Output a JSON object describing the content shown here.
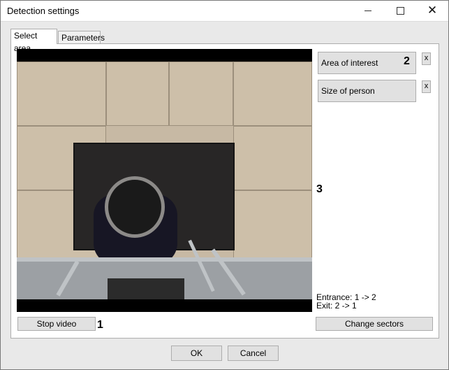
{
  "window": {
    "title": "Detection settings",
    "controls": {
      "minimize_icon": "minimize-icon",
      "maximize_icon": "maximize-icon",
      "close_icon": "close-icon",
      "close_glyph": "✕"
    }
  },
  "tabs": [
    {
      "label": "Select area",
      "active": true
    },
    {
      "label": "Parameters",
      "active": false
    }
  ],
  "side_panel": {
    "area_of_interest_label": "Area of interest",
    "size_of_person_label": "Size of person",
    "remove_label": "x",
    "entrance_text": "Entrance: 1 -> 2",
    "exit_text": "Exit: 2 -> 1"
  },
  "callouts": {
    "one": "1",
    "two": "2",
    "three": "3"
  },
  "buttons": {
    "stop_video": "Stop video",
    "change_sectors": "Change sectors",
    "ok": "OK",
    "cancel": "Cancel"
  },
  "colors": {
    "window_bg": "#e9e9e9",
    "button_bg": "#e1e1e1",
    "outer_bg": "#4a4a4a"
  }
}
